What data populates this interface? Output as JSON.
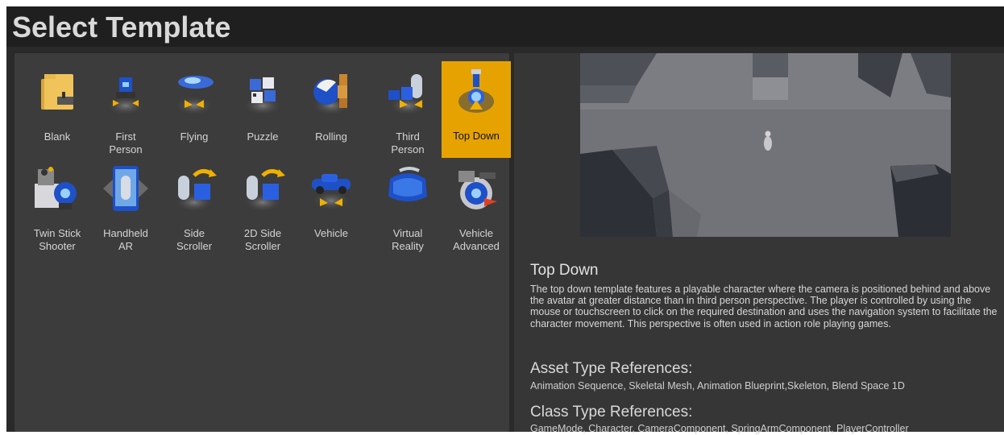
{
  "window": {
    "title": "Select Template"
  },
  "templates": [
    {
      "label": "Blank",
      "icon": "folder-icon",
      "selected": false
    },
    {
      "label": "First\nPerson",
      "icon": "first-person-icon",
      "selected": false
    },
    {
      "label": "Flying",
      "icon": "flying-icon",
      "selected": false
    },
    {
      "label": "Puzzle",
      "icon": "puzzle-icon",
      "selected": false
    },
    {
      "label": "Rolling",
      "icon": "rolling-icon",
      "selected": false
    },
    {
      "label": "Third\nPerson",
      "icon": "third-person-icon",
      "selected": false
    },
    {
      "label": "Top Down",
      "icon": "top-down-icon",
      "selected": true
    },
    {
      "label": "Twin Stick\nShooter",
      "icon": "twin-stick-icon",
      "selected": false
    },
    {
      "label": "Handheld\nAR",
      "icon": "handheld-ar-icon",
      "selected": false
    },
    {
      "label": "Side\nScroller",
      "icon": "side-scroller-icon",
      "selected": false
    },
    {
      "label": "2D Side\nScroller",
      "icon": "2d-side-scroller-icon",
      "selected": false
    },
    {
      "label": "Vehicle",
      "icon": "vehicle-icon",
      "selected": false
    },
    {
      "label": "Virtual\nReality",
      "icon": "vr-headset-icon",
      "selected": false
    },
    {
      "label": "Vehicle\nAdvanced",
      "icon": "vehicle-advanced-icon",
      "selected": false
    }
  ],
  "details": {
    "title": "Top Down",
    "description": "The top down template features a playable character where the camera is positioned behind and above the avatar at greater distance than in third person perspective. The player is controlled by using the mouse or touchscreen to click on the required destination and uses the navigation system to facilitate the character movement. This perspective is often used in action role playing games.",
    "asset_heading": "Asset Type References:",
    "asset_refs": "Animation Sequence, Skeletal Mesh, Animation Blueprint,Skeleton, Blend Space 1D",
    "class_heading": "Class Type References:",
    "class_refs": "GameMode, Character, CameraComponent, SpringArmComponent, PlayerController"
  },
  "colors": {
    "selected": "#e6a300",
    "background": "#2a2a2a",
    "panel": "#3c3c3c"
  }
}
